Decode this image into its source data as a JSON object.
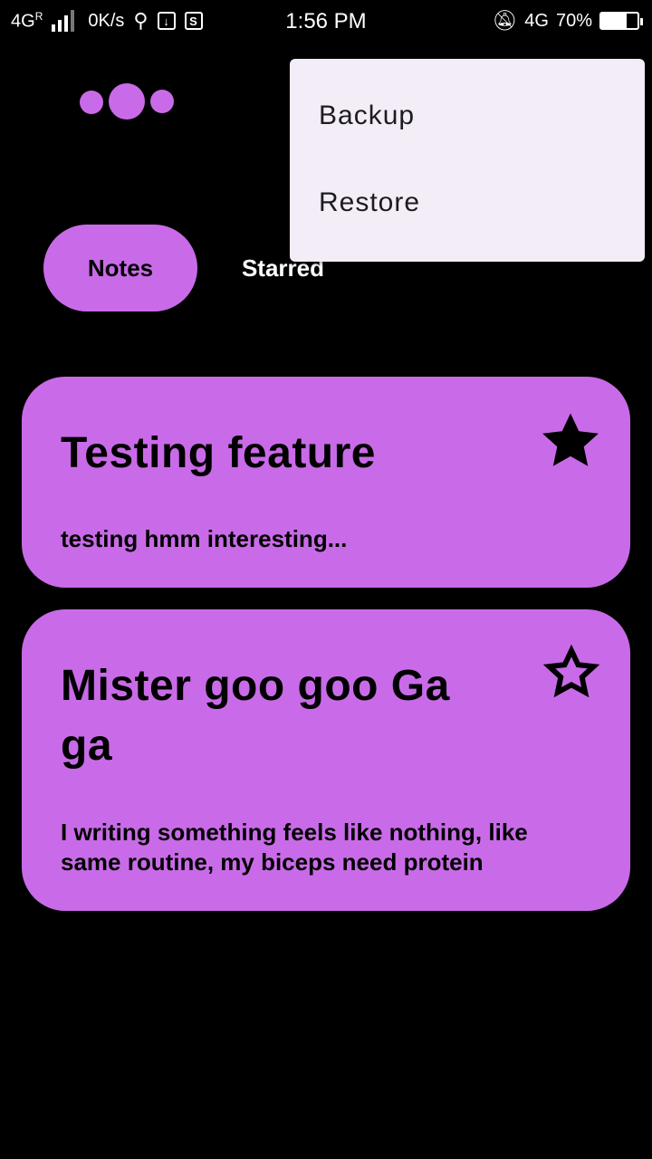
{
  "status_bar": {
    "network_left": "4G",
    "roaming": "R",
    "speed": "0K/s",
    "time": "1:56 PM",
    "network_right": "4G",
    "battery": "70%",
    "icons": [
      "signal-icon",
      "usb-icon",
      "download-icon",
      "screenshot-icon",
      "silent-icon",
      "battery-icon"
    ]
  },
  "tabs": [
    {
      "label": "Notes",
      "selected": true
    },
    {
      "label": "Starred",
      "selected": false
    }
  ],
  "menu": {
    "items": [
      "Backup",
      "Restore"
    ]
  },
  "notes": [
    {
      "title": "Testing feature",
      "body": "testing hmm interesting...",
      "starred": true
    },
    {
      "title": "Mister goo goo Ga ga",
      "body": "I writing something feels like nothing, like same routine, my biceps need protein",
      "starred": false
    }
  ],
  "colors": {
    "accent": "#c96be8",
    "background": "#000000",
    "menu_bg": "#f3edf7"
  }
}
